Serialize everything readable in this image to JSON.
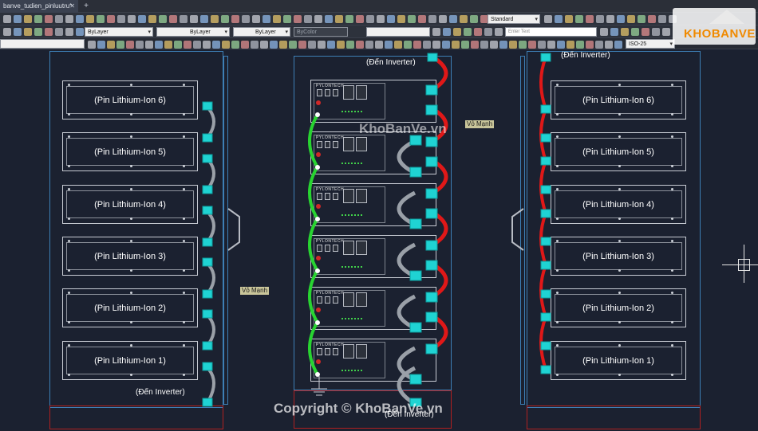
{
  "tabbar": {
    "doc_tab_label": "banve_tudien_pinluutru*",
    "close_glyph": "✕",
    "new_tab_glyph": "+"
  },
  "toolbar2": {
    "layer_label": "ByLayer",
    "linetype_label": "ByLayer",
    "lineweight_label": "ByLayer",
    "color_label": "ByColor",
    "text_style_label": "Standard",
    "find_text_placeholder": "Enter Text",
    "dim_style_label": "ISO-25"
  },
  "drawing": {
    "left_batteries": [
      "(Pin Lithium-Ion 6)",
      "(Pin Lithium-Ion 5)",
      "(Pin Lithium-Ion 4)",
      "(Pin Lithium-Ion 3)",
      "(Pin Lithium-Ion 2)",
      "(Pin Lithium-Ion 1)"
    ],
    "right_batteries": [
      "(Pin Lithium-Ion 6)",
      "(Pin Lithium-Ion 5)",
      "(Pin Lithium-Ion 4)",
      "(Pin Lithium-Ion 3)",
      "(Pin Lithium-Ion 2)",
      "(Pin Lithium-Ion 1)"
    ],
    "inverter_label": "(Đến Inverter)",
    "enclosure_tag": "Vỏ Mạnh",
    "module_brand": "PYLONTECH",
    "watermark_center": "KhoBanVe.vn",
    "copyright": "Copyright © KhoBanVe.vn",
    "logo_text": "KHOBANVE"
  },
  "colors": {
    "canvas": "#1b2130",
    "terminal": "#1fd3d3",
    "positive_cable": "#e01818",
    "negative_cable": "#9aa0a8",
    "link_cable": "#28d431",
    "cabinet": "#3d7fb5"
  }
}
